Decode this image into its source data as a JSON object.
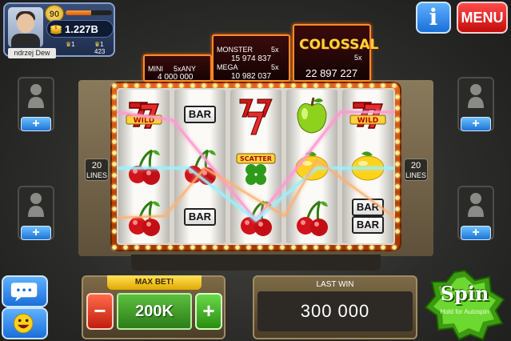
{
  "player": {
    "level": "90",
    "name": "ndrzej Dew",
    "coins": "1.227B",
    "stat_crowns": "1",
    "stat_second": "1 423",
    "xp_fraction": 0.55
  },
  "top_buttons": {
    "info_label": "i",
    "menu_label": "MENU"
  },
  "jackpots": {
    "mini": {
      "label": "MINI",
      "multiplier": "5xANY",
      "value": "4 000 000"
    },
    "monster": {
      "label": "MONSTER",
      "multiplier": "5x",
      "value": "15 974 837"
    },
    "mega": {
      "label": "MEGA",
      "multiplier": "5x",
      "value": "10 982 037"
    },
    "colossal": {
      "label": "COLOSSAL",
      "multiplier": "5x",
      "value": "22 897 227"
    }
  },
  "lines": {
    "count": "20",
    "label": "LINES"
  },
  "reels": [
    [
      "triple-seven-icon",
      "cherry-icon",
      "cherry-icon"
    ],
    [
      "bar-icon",
      "cherry-icon",
      "bar-icon"
    ],
    [
      "triple-seven-icon",
      "scatter-icon",
      "cherry-icon"
    ],
    [
      "apple-icon",
      "lemon-icon",
      "cherry-icon"
    ],
    [
      "triple-seven-icon",
      "lemon-icon",
      "double-bar-icon"
    ]
  ],
  "symbol_text": {
    "bar": "BAR",
    "scatter": "SCATTER",
    "wild": "WILD"
  },
  "bet": {
    "maxbet_label": "MAX BET!",
    "minus_label": "−",
    "value": "200K",
    "plus_label": "+"
  },
  "last_win": {
    "label": "LAST WIN",
    "value": "300 000"
  },
  "spin": {
    "label": "Spin",
    "sub_label": "Hold for Autospin"
  },
  "colors": {
    "frame": "#e0641a",
    "bulb": "#ffc23a",
    "spin_green": "#4caf1f",
    "info_blue": "#1a6fd8",
    "menu_red": "#c30d0d"
  }
}
